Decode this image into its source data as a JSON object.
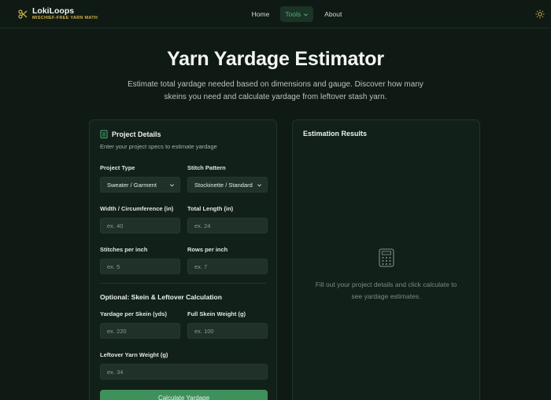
{
  "brand": {
    "name": "LokiLoops",
    "tagline": "MISCHIEF-FREE YARN MATH"
  },
  "nav": {
    "home": "Home",
    "tools": "Tools",
    "about": "About"
  },
  "hero": {
    "title": "Yarn Yardage Estimator",
    "description": "Estimate total yardage needed based on dimensions and gauge. Discover how many skeins you need and calculate yardage from leftover stash yarn."
  },
  "details": {
    "title": "Project Details",
    "subtitle": "Enter your project specs to estimate yardage",
    "project_type": {
      "label": "Project Type",
      "value": "Sweater / Garment"
    },
    "stitch_pattern": {
      "label": "Stitch Pattern",
      "value": "Stockinette / Standard"
    },
    "width": {
      "label": "Width / Circumference (in)",
      "placeholder": "ex. 40"
    },
    "length": {
      "label": "Total Length (in)",
      "placeholder": "ex. 24"
    },
    "spi": {
      "label": "Stitches per inch",
      "placeholder": "ex. 5"
    },
    "rpi": {
      "label": "Rows per inch",
      "placeholder": "ex. 7"
    },
    "optional_title": "Optional: Skein & Leftover Calculation",
    "yardage_skein": {
      "label": "Yardage per Skein (yds)",
      "placeholder": "ex. 220"
    },
    "skein_weight": {
      "label": "Full Skein Weight (g)",
      "placeholder": "ex. 100"
    },
    "leftover": {
      "label": "Leftover Yarn Weight (g)",
      "placeholder": "ex. 34"
    },
    "button": "Calculate Yardage"
  },
  "results": {
    "title": "Estimation Results",
    "empty_line1": "Fill out your project details and click calculate to",
    "empty_line2": "see yardage estimates."
  },
  "colors": {
    "accent": "#3f915b",
    "brand_gold": "#d4b24a",
    "background": "#0f1a14"
  },
  "icons": {
    "logo": "scissors-icon",
    "theme": "sun-icon",
    "details": "clipboard-icon",
    "results": "calculator-icon",
    "select": "chevron-down-icon"
  }
}
